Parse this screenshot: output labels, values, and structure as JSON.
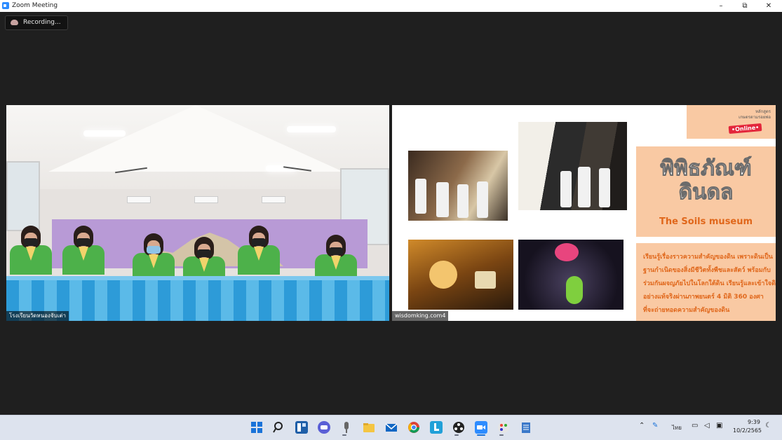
{
  "window": {
    "title": "Zoom Meeting",
    "minimize": "–",
    "maximize": "⧉",
    "close": "✕"
  },
  "recording": {
    "label": "Recording..."
  },
  "participants": [
    {
      "name": "โรงเรียนวัดหนองจับเต่า"
    },
    {
      "name": "wisdomking.com4"
    }
  ],
  "slide": {
    "brand_top": "หลักสูตร\nเกษตรตามรอยพ่อ",
    "brand_online": "•Online•",
    "title_th_1": "พิพิธภัณฑ์",
    "title_th_2": "ดินดล",
    "title_en": "The Soils museum",
    "description": [
      "เรียนรู้เรื่องราวความสำคัญของดิน เพราะดินเป็น",
      "ฐานกำเนิดของสิ่งมีชีวิตทั้งพืชและสัตว์ พร้อมกับ",
      "ร่วมกันผจญภัยไปในโลกใต้ดิน เรียนรู้และเข้าใจดิน",
      "อย่างแท้จริงผ่านภาพยนตร์ 4 มิติ 360 องศา",
      "ที่จะถ่ายทอดความสำคัญของดิน"
    ]
  },
  "taskbar": {
    "apps": [
      "start-icon",
      "search-icon",
      "widgets-icon",
      "chat-icon",
      "mic-icon",
      "file-explorer-icon",
      "mail-icon",
      "chrome-icon",
      "line-icon",
      "obs-icon",
      "zoom-icon",
      "paint-icon",
      "notepad-icon"
    ],
    "language": "ไทย",
    "time": "9:39",
    "date": "10/2/2565"
  },
  "colors": {
    "accent": "#e0671b",
    "slide_panel": "#f9c9a3",
    "online_badge": "#e3263b",
    "taskbar": "#dde3ee",
    "background": "#1f1f1f"
  }
}
